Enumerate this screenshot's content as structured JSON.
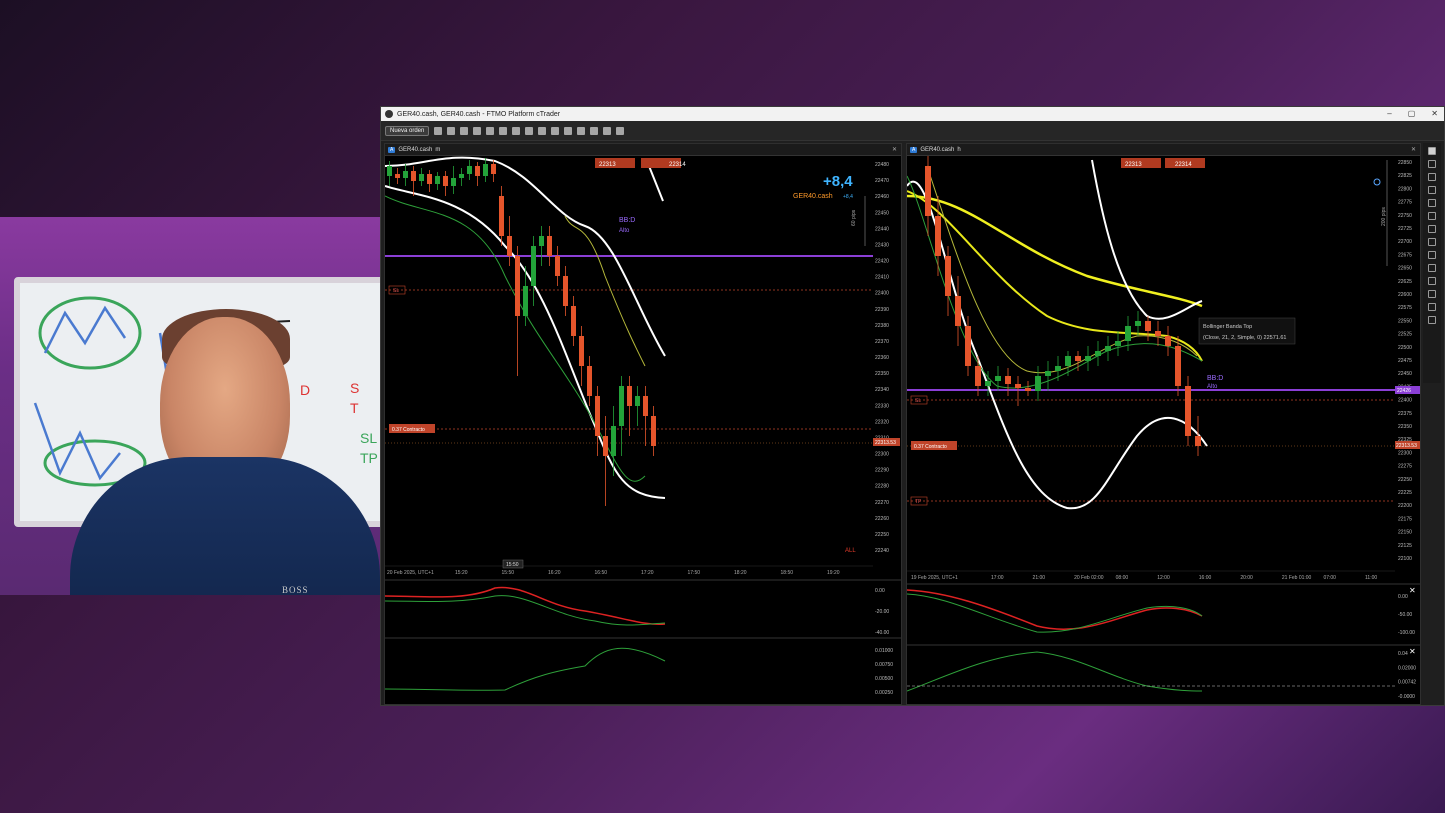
{
  "window": {
    "title": "GER40.cash, GER40.cash - FTMO Platform cTrader",
    "controls": [
      "–",
      "▢",
      "✕"
    ]
  },
  "toolbar": {
    "new_order_label": "Nueva orden"
  },
  "webcam": {
    "shirt_logo": "BOSS"
  },
  "left_chart": {
    "tab_label": "GER40.cash",
    "timeframe": "m",
    "bid_box": "22313",
    "bid_sup": "91",
    "ask_box": "22314",
    "ask_sup": "22",
    "pnl": "+8,4",
    "pnl_symbol": "GER40.cash",
    "pnl_small": "+8,4",
    "pips_label": "60 pips",
    "bb_label": "BB:D",
    "bb_sub": "Alto",
    "sl_label": "SL",
    "contract_label": "0.37 Contracto",
    "all_label": "ALL",
    "price_ticks": [
      "22480",
      "22470",
      "22460",
      "22450",
      "22440",
      "22430",
      "22420",
      "22410",
      "22400",
      "22390",
      "22380",
      "22370",
      "22360",
      "22350",
      "22340",
      "22330",
      "22320",
      "22310",
      "22300",
      "22290",
      "22280",
      "22270",
      "22260",
      "22250",
      "22240"
    ],
    "price_tick_suffix": "00",
    "current_price": "22313.53",
    "date_label": "20 Feb 2025, UTC+1",
    "time_ticks": [
      "15:20",
      "15:50",
      "16:20",
      "16:50",
      "17:20",
      "17:50",
      "18:20",
      "18:50",
      "19:20"
    ],
    "cursor_time": "15:50",
    "osc1_ticks": [
      "0.00",
      "-20.00",
      "-40.00"
    ],
    "osc2_ticks": [
      "0.01000",
      "0.00750",
      "0.00500",
      "0.00250"
    ],
    "colors": {
      "bull": "#23a33a",
      "bear": "#e5552b",
      "band": "#ffffff",
      "inner": "#b5b83a",
      "support": "#8b3fd6"
    }
  },
  "right_chart": {
    "tab_label": "GER40.cash",
    "timeframe": "h",
    "bid_box": "22313",
    "bid_sup": "91",
    "ask_box": "22314",
    "ask_sup": "22",
    "pips_label": "200 pips",
    "bb_label": "BB:D",
    "bb_sub": "Alto",
    "sl_label": "SL",
    "tp_label": "TP",
    "contract_label": "0.37 Contracto",
    "tooltip_title": "Bollinger Banda Top",
    "tooltip_detail": "(Close, 21, 2, Simple, 0)  22571.61",
    "price_ticks": [
      "22850",
      "22825",
      "22800",
      "22775",
      "22750",
      "22725",
      "22700",
      "22675",
      "22650",
      "22625",
      "22600",
      "22575",
      "22550",
      "22525",
      "22500",
      "22475",
      "22450",
      "22425",
      "22400",
      "22375",
      "22350",
      "22325",
      "22300",
      "22275",
      "22250",
      "22225",
      "22200",
      "22175",
      "22150",
      "22125",
      "22100"
    ],
    "price_tick_suffix": "00",
    "current_price": "22313.53",
    "support_price": "22426",
    "date_label": "19 Feb 2025, UTC+1",
    "time_ticks": [
      "17:00",
      "21:00",
      "20 Feb 02:00",
      "08:00",
      "12:00",
      "16:00",
      "20:00",
      "21 Feb 01:00",
      "07:00",
      "11:00"
    ],
    "osc1_ticks": [
      "0.00",
      "-50.00",
      "-100.00"
    ],
    "osc2_ticks": [
      "0.04",
      "0.02000",
      "0.00742",
      "-0.0000"
    ]
  }
}
